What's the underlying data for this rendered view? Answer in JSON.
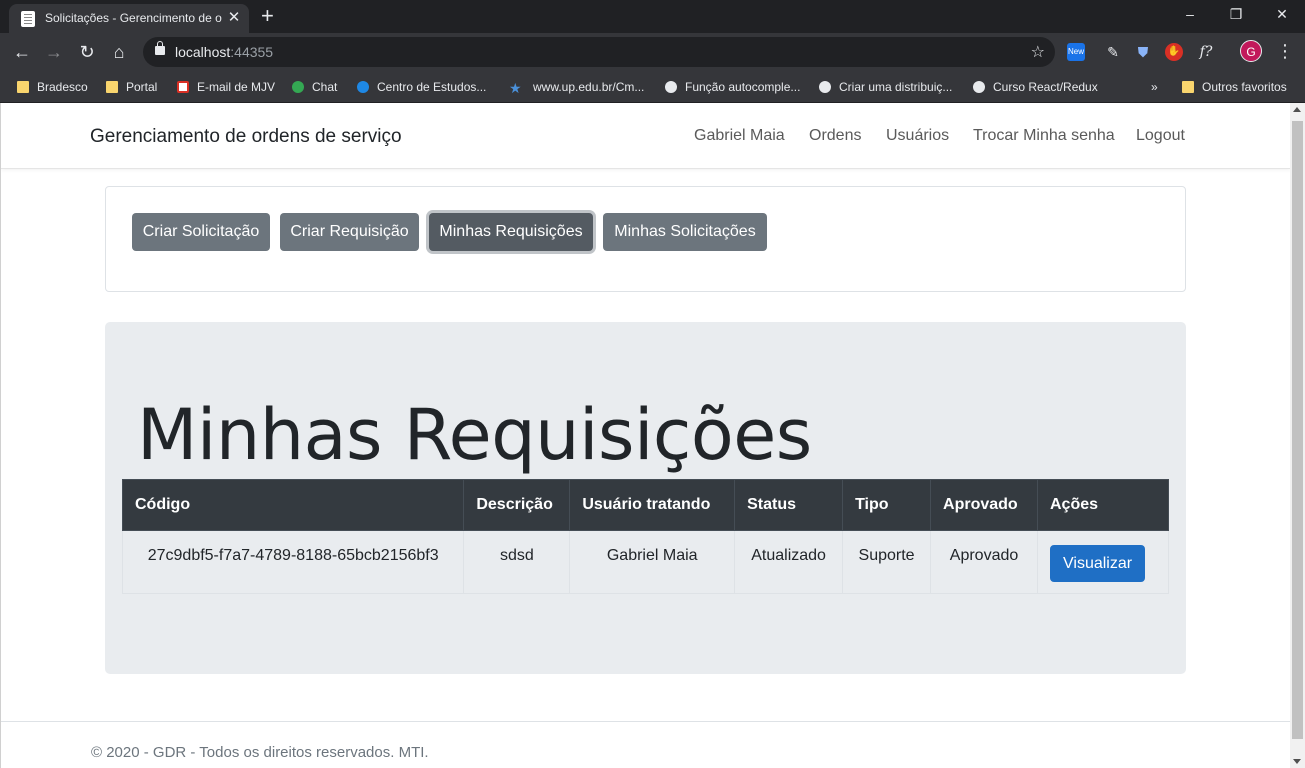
{
  "browser": {
    "tab_title": "Solicitações - Gerencimento de o",
    "url_host": "localhost",
    "url_port": ":44355",
    "ext_new_label": "New",
    "avatar_letter": "G",
    "bookmarks": [
      "Bradesco",
      "Portal",
      "E-mail de MJV",
      "Chat",
      "Centro de Estudos...",
      "www.up.edu.br/Cm...",
      "Função autocomple...",
      "Criar uma distribuiç...",
      "Curso React/Redux",
      "Outros favoritos"
    ],
    "more_bookmarks": "»"
  },
  "navbar": {
    "brand": "Gerenciamento de ordens de serviço",
    "links": [
      "Gabriel Maia",
      "Ordens",
      "Usuários",
      "Trocar Minha senha",
      "Logout"
    ]
  },
  "actions": {
    "buttons": [
      "Criar Solicitação",
      "Criar Requisição",
      "Minhas Requisições",
      "Minhas Solicitações"
    ],
    "active": "Minhas Requisições"
  },
  "main": {
    "title": "Minhas Requisições",
    "table": {
      "headers": [
        "Código",
        "Descrição",
        "Usuário tratando",
        "Status",
        "Tipo",
        "Aprovado",
        "Ações"
      ],
      "rows": [
        {
          "codigo": "27c9dbf5-f7a7-4789-8188-65bcb2156bf3",
          "descricao": "sdsd",
          "usuario": "Gabriel Maia",
          "status": "Atualizado",
          "tipo": "Suporte",
          "aprovado": "Aprovado",
          "acao": "Visualizar"
        }
      ]
    }
  },
  "footer": {
    "text": "© 2020 - GDR - Todos os direitos reservados. MTI."
  },
  "colors": {
    "primary": "#1f6fc5",
    "secondary": "#6c757d",
    "dark": "#343a40",
    "jumbotron": "#e9ecef"
  }
}
